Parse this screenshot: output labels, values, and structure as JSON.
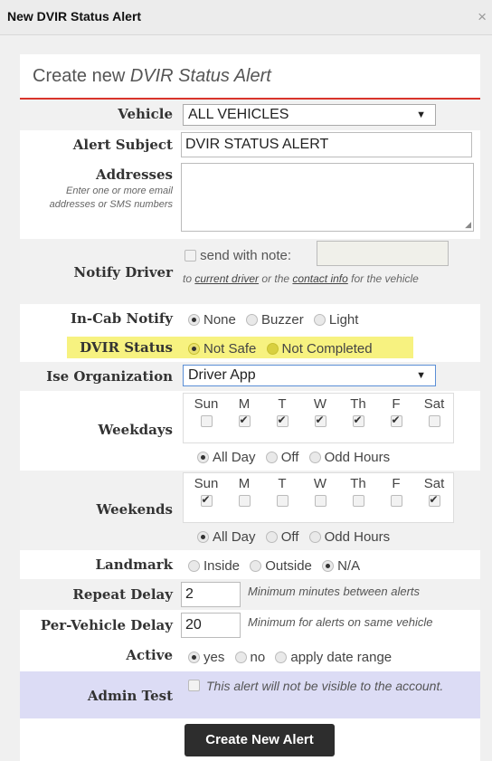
{
  "dialog": {
    "title": "New DVIR Status Alert",
    "close_glyph": "×"
  },
  "panel": {
    "heading_prefix": "Create new",
    "heading_em": "DVIR Status Alert"
  },
  "vehicle": {
    "label": "Vehicle",
    "value": "ALL VEHICLES"
  },
  "subject": {
    "label": "Alert Subject",
    "value": "DVIR STATUS ALERT"
  },
  "addresses": {
    "label": "Addresses",
    "hint": "Enter one or more email addresses or SMS numbers",
    "value": ""
  },
  "notify_driver": {
    "label": "Notify Driver",
    "checkbox_label": "send with note:",
    "checked": false,
    "note_prefix": "to",
    "link1": "current driver",
    "note_mid": "or the",
    "link2": "contact info",
    "note_suffix": "for the vehicle"
  },
  "in_cab": {
    "label": "In-Cab Notify",
    "options": [
      "None",
      "Buzzer",
      "Light"
    ],
    "selected": "None"
  },
  "dvir_status": {
    "label": "DVIR Status",
    "options": [
      "Not Safe",
      "Not Completed"
    ],
    "selected": "Not Safe",
    "highlight_color": "#f7f280"
  },
  "ise_org": {
    "label": "Ise Organization",
    "value": "Driver App"
  },
  "weekdays": {
    "label": "Weekdays",
    "days": [
      "Sun",
      "M",
      "T",
      "W",
      "Th",
      "F",
      "Sat"
    ],
    "checked": [
      false,
      true,
      true,
      true,
      true,
      true,
      false
    ],
    "time_options": [
      "All Day",
      "Off",
      "Odd Hours"
    ],
    "time_selected": "All Day"
  },
  "weekends": {
    "label": "Weekends",
    "days": [
      "Sun",
      "M",
      "T",
      "W",
      "Th",
      "F",
      "Sat"
    ],
    "checked": [
      true,
      false,
      false,
      false,
      false,
      false,
      true
    ],
    "time_options": [
      "All Day",
      "Off",
      "Odd Hours"
    ],
    "time_selected": "All Day"
  },
  "landmark": {
    "label": "Landmark",
    "options": [
      "Inside",
      "Outside",
      "N/A"
    ],
    "selected": "N/A"
  },
  "repeat_delay": {
    "label": "Repeat Delay",
    "value": "2",
    "hint": "Minimum minutes between alerts"
  },
  "per_vehicle_delay": {
    "label": "Per-Vehicle Delay",
    "value": "20",
    "hint": "Minimum for alerts on same vehicle"
  },
  "active": {
    "label": "Active",
    "options": [
      "yes",
      "no",
      "apply date range"
    ],
    "selected": "yes"
  },
  "admin_test": {
    "label": "Admin Test",
    "note": "This alert will not be visible to the account.",
    "checked": false
  },
  "submit": {
    "label": "Create New Alert"
  },
  "colors": {
    "accent": "#d9342b",
    "admin_row": "#dcdcf5",
    "button": "#2d2d2d"
  }
}
